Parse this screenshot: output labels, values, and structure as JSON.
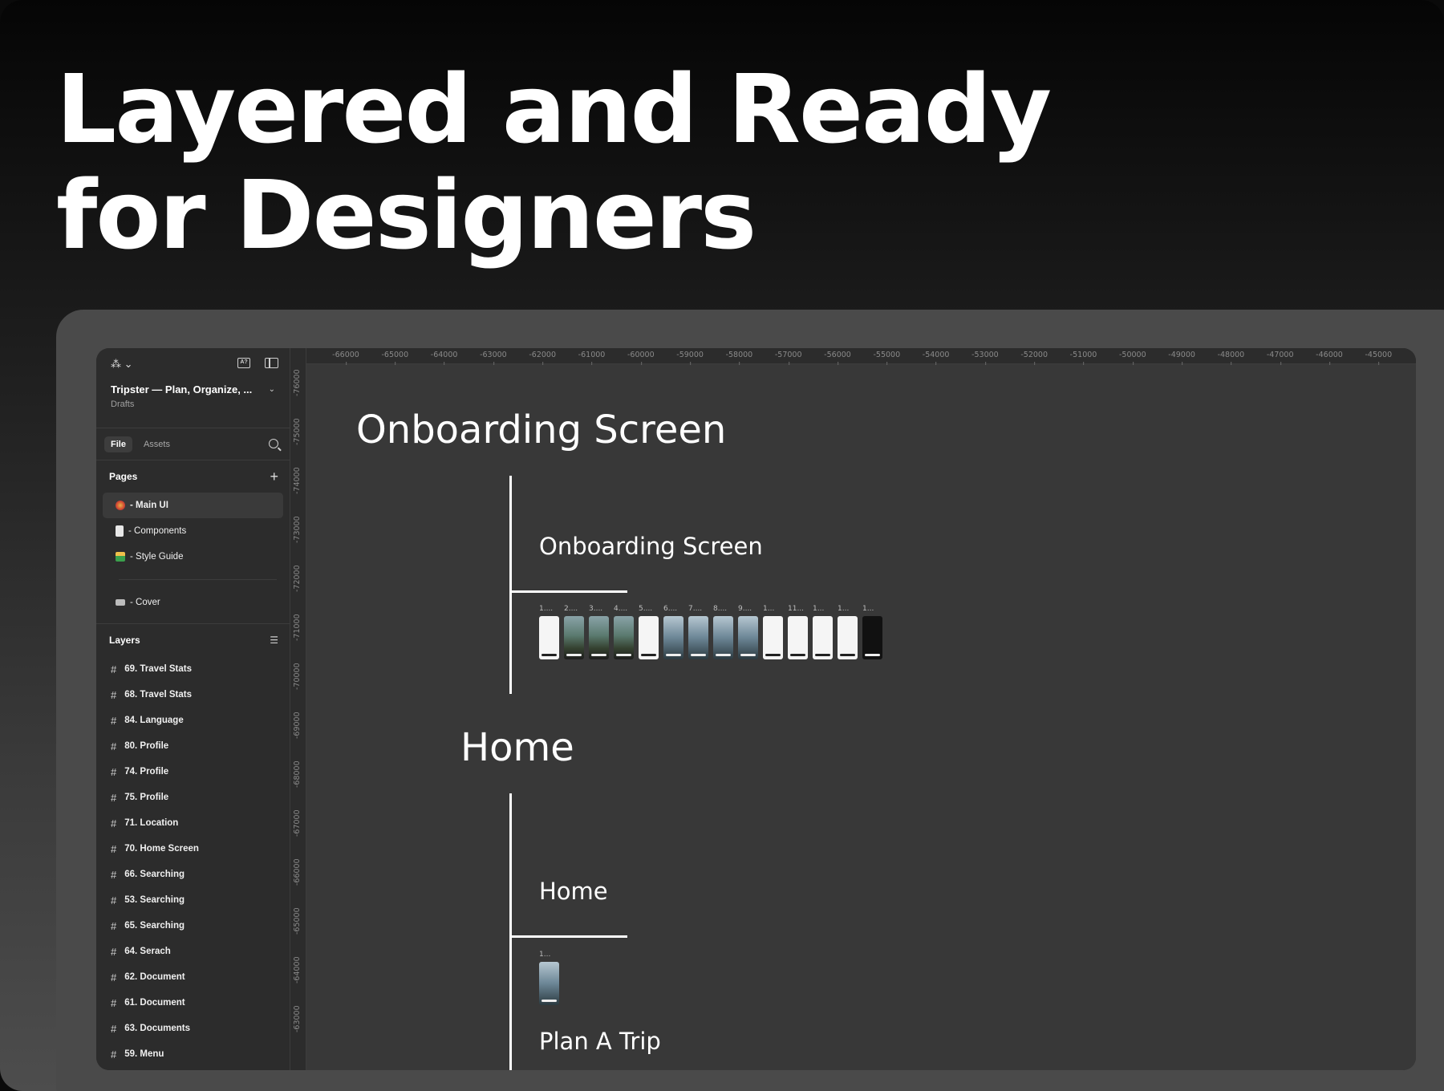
{
  "headline": {
    "line1": "Layered and Ready",
    "line2": "for Designers"
  },
  "sidebar": {
    "logo_icon": "figma-icon",
    "file_title": "Tripster — Plan, Organize, ...",
    "file_subtitle": "Drafts",
    "tabs": [
      "File",
      "Assets"
    ],
    "pages_heading": "Pages",
    "pages": [
      {
        "label": "- Main UI",
        "active": true
      },
      {
        "label": "- Components"
      },
      {
        "label": "- Style Guide"
      },
      {
        "label": "- Cover"
      }
    ],
    "layers_heading": "Layers",
    "layers": [
      "69. Travel Stats",
      "68. Travel Stats",
      "84. Language",
      "80. Profile",
      "74. Profile",
      "75. Profile",
      "71. Location",
      "70. Home Screen",
      "66. Searching",
      "53. Searching",
      "65. Searching",
      "64. Serach",
      "62. Document",
      "61. Document",
      "63. Documents",
      "59. Menu"
    ]
  },
  "ruler": {
    "horizontal": [
      "-66000",
      "-65000",
      "-64000",
      "-63000",
      "-62000",
      "-61000",
      "-60000",
      "-59000",
      "-58000",
      "-57000",
      "-56000",
      "-55000",
      "-54000",
      "-53000",
      "-52000",
      "-51000",
      "-50000",
      "-49000",
      "-48000",
      "-47000",
      "-46000",
      "-45000"
    ],
    "vertical": [
      "-76000",
      "-75000",
      "-74000",
      "-73000",
      "-72000",
      "-71000",
      "-70000",
      "-69000",
      "-68000",
      "-67000",
      "-66000",
      "-65000",
      "-64000",
      "-63000"
    ]
  },
  "canvas": {
    "section1_title": "Onboarding Screen",
    "section1_subtitle": "Onboarding Screen",
    "section1_thumb_labels": [
      "1....",
      "2....",
      "3....",
      "4....",
      "5....",
      "6....",
      "7....",
      "8....",
      "9....",
      "1...",
      "11...",
      "1...",
      "1...",
      "1..."
    ],
    "section2_title": "Home",
    "section2_subtitle": "Home",
    "section2_thumb_labels": [
      "1..."
    ],
    "section3_subtitle": "Plan A Trip"
  }
}
